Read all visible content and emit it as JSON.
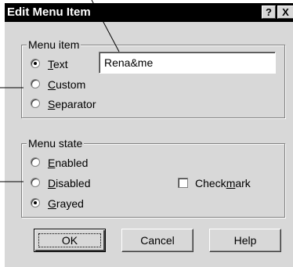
{
  "dialog": {
    "title": "Edit Menu Item",
    "help_glyph": "?",
    "close_glyph": "X"
  },
  "menu_item": {
    "legend": "Menu item",
    "text_value": "Rena&me",
    "options": [
      {
        "prefix": "",
        "accel": "T",
        "suffix": "ext",
        "selected": true
      },
      {
        "prefix": "",
        "accel": "C",
        "suffix": "ustom",
        "selected": false
      },
      {
        "prefix": "",
        "accel": "S",
        "suffix": "eparator",
        "selected": false
      }
    ]
  },
  "menu_state": {
    "legend": "Menu state",
    "options": [
      {
        "prefix": "",
        "accel": "E",
        "suffix": "nabled",
        "selected": false
      },
      {
        "prefix": "",
        "accel": "D",
        "suffix": "isabled",
        "selected": false
      },
      {
        "prefix": "",
        "accel": "G",
        "suffix": "rayed",
        "selected": true
      }
    ],
    "checkmark": {
      "prefix": "Check",
      "accel": "m",
      "suffix": "ark",
      "checked": false
    }
  },
  "buttons": {
    "ok": "OK",
    "cancel": "Cancel",
    "help": "Help"
  }
}
